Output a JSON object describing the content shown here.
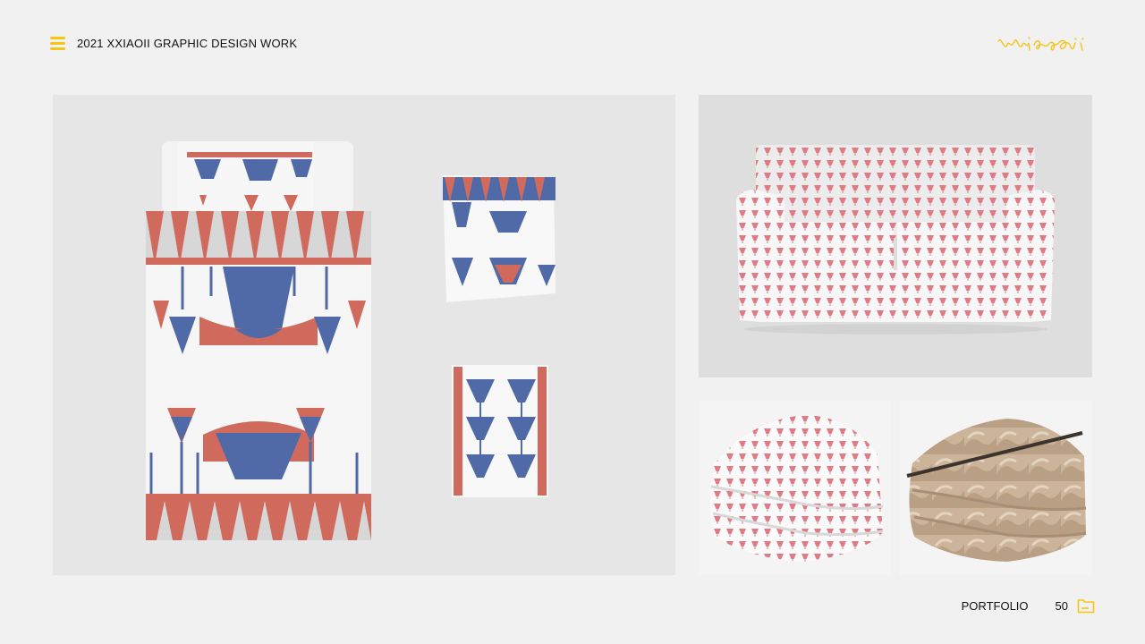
{
  "header": {
    "title": "2021 XXIAOII GRAPHIC DESIGN WORK",
    "icon": "menu-icon",
    "signature": "Xxiaoii",
    "accent_color": "#f5c518"
  },
  "footer": {
    "label": "PORTFOLIO",
    "page_number": "50",
    "icon": "folder-icon"
  },
  "palette": {
    "coral": "#d06a5c",
    "blue": "#4f6aa6",
    "grey": "#d7d7d7",
    "beige": "#bfa68a"
  },
  "gallery": [
    {
      "id": "bedding-set",
      "icon": "bedding-mockup"
    },
    {
      "id": "sofa",
      "icon": "sofa-mockup"
    },
    {
      "id": "blanket-red",
      "icon": "folded-blanket-mockup"
    },
    {
      "id": "blanket-beige",
      "icon": "folded-blanket-mockup"
    }
  ]
}
